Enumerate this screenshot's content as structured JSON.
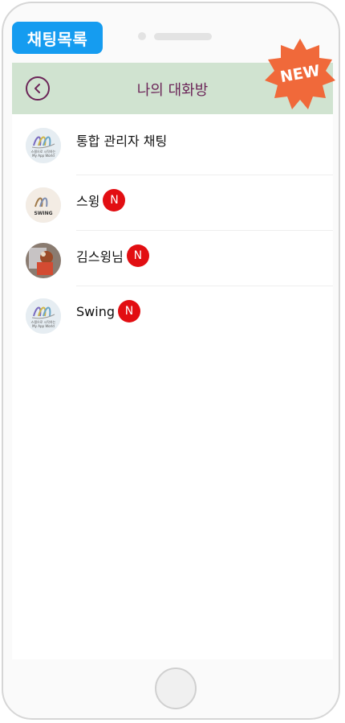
{
  "tag": {
    "label": "채팅목록"
  },
  "header": {
    "title": "나의 대화방",
    "back_icon": "back-icon"
  },
  "new_badge": {
    "label": "NEW"
  },
  "chats": [
    {
      "name": "통합 관리자 채팅",
      "new": false,
      "avatar_text": [
        "스윙으로 시작하는",
        "My App World"
      ]
    },
    {
      "name": "스윙",
      "new": true,
      "badge": "N",
      "avatar_text": [
        "SWING"
      ]
    },
    {
      "name": "김스윙님",
      "new": true,
      "badge": "N"
    },
    {
      "name": "Swing",
      "new": true,
      "badge": "N",
      "avatar_text": [
        "스윙으로 시작하는",
        "My App World"
      ]
    }
  ],
  "colors": {
    "accent": "#159cf0",
    "header_bg": "#d0e3d0",
    "title": "#6b2558",
    "badge": "#e20e12",
    "new_star": "#f0693a"
  }
}
